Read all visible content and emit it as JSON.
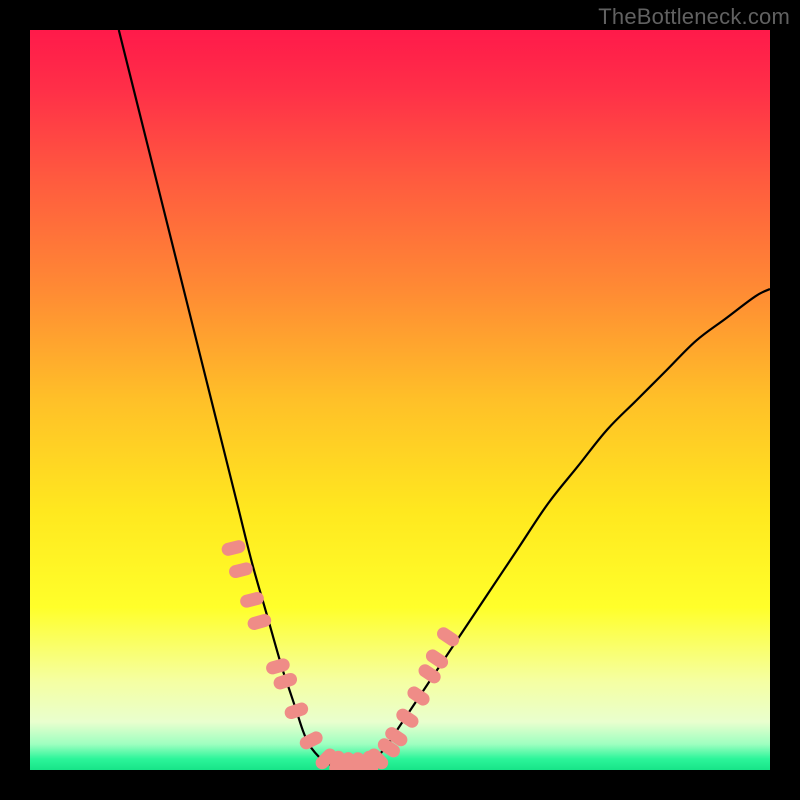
{
  "watermark": "TheBottleneck.com",
  "colors": {
    "frame": "#000000",
    "watermark": "#616161",
    "curve": "#000000",
    "marker": "#ef8c87",
    "gradient_stops": [
      {
        "offset": 0.0,
        "color": "#ff1a4a"
      },
      {
        "offset": 0.08,
        "color": "#ff2f48"
      },
      {
        "offset": 0.2,
        "color": "#ff5a3f"
      },
      {
        "offset": 0.35,
        "color": "#ff8a34"
      },
      {
        "offset": 0.5,
        "color": "#ffc028"
      },
      {
        "offset": 0.65,
        "color": "#ffe81f"
      },
      {
        "offset": 0.78,
        "color": "#ffff2a"
      },
      {
        "offset": 0.88,
        "color": "#f5ffa2"
      },
      {
        "offset": 0.935,
        "color": "#e9ffce"
      },
      {
        "offset": 0.965,
        "color": "#9effc0"
      },
      {
        "offset": 0.985,
        "color": "#2cf59a"
      },
      {
        "offset": 1.0,
        "color": "#17e488"
      }
    ]
  },
  "chart_data": {
    "type": "line",
    "title": "",
    "xlabel": "",
    "ylabel": "",
    "xlim": [
      0,
      100
    ],
    "ylim": [
      0,
      100
    ],
    "series": [
      {
        "name": "bottleneck-curve",
        "x": [
          12,
          14,
          16,
          18,
          20,
          22,
          24,
          26,
          28,
          30,
          32,
          34,
          35,
          36,
          37,
          38,
          40,
          42,
          44,
          46,
          48,
          50,
          54,
          58,
          62,
          66,
          70,
          74,
          78,
          82,
          86,
          90,
          94,
          98,
          100
        ],
        "y": [
          100,
          92,
          84,
          76,
          68,
          60,
          52,
          44,
          36,
          28,
          21,
          14,
          11,
          8,
          5,
          3,
          1,
          0.5,
          0.5,
          1,
          3,
          6,
          12,
          18,
          24,
          30,
          36,
          41,
          46,
          50,
          54,
          58,
          61,
          64,
          65
        ]
      }
    ],
    "markers": {
      "name": "highlight-points",
      "x": [
        27.5,
        28.5,
        30.0,
        31.0,
        33.5,
        34.5,
        36.0,
        38.0,
        40.0,
        41.5,
        43.0,
        44.5,
        46.0,
        47.0,
        48.5,
        49.5,
        51.0,
        52.5,
        54.0,
        55.0,
        56.5
      ],
      "y": [
        30,
        27,
        23,
        20,
        14,
        12,
        8,
        4,
        1.5,
        1,
        0.8,
        0.8,
        1,
        1.5,
        3,
        4.5,
        7,
        10,
        13,
        15,
        18
      ]
    }
  }
}
